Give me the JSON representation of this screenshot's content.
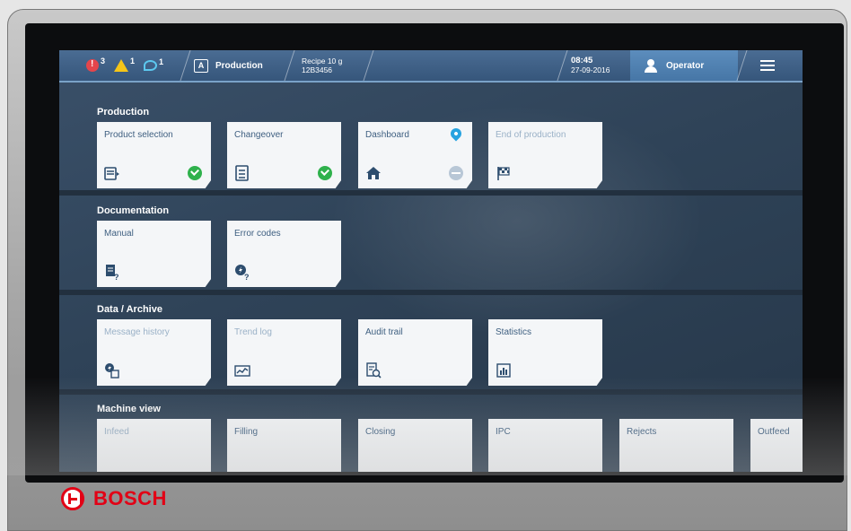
{
  "topbar": {
    "errors": {
      "count": "3",
      "icon": "error-icon"
    },
    "warnings": {
      "count": "1",
      "icon": "warning-icon"
    },
    "messages": {
      "count": "1",
      "icon": "message-icon"
    },
    "mode_icon_letter": "A",
    "mode_label": "Production",
    "recipe_name": "Recipe 10 g",
    "recipe_id": "12B3456",
    "time": "08:45",
    "date": "27-09-2016",
    "user": "Operator"
  },
  "sections": [
    {
      "title": "Production",
      "tiles": [
        {
          "label": "Product selection",
          "icon": "product-selection-icon",
          "status": "ok",
          "enabled": true
        },
        {
          "label": "Changeover",
          "icon": "checklist-icon",
          "status": "ok",
          "enabled": true
        },
        {
          "label": "Dashboard",
          "icon": "home-icon",
          "status": "inactive",
          "pinned": true,
          "enabled": true
        },
        {
          "label": "End of production",
          "icon": "finish-flag-icon",
          "status": "",
          "enabled": false
        }
      ]
    },
    {
      "title": "Documentation",
      "tiles": [
        {
          "label": "Manual",
          "icon": "manual-icon",
          "enabled": true
        },
        {
          "label": "Error codes",
          "icon": "error-codes-icon",
          "enabled": true
        }
      ]
    },
    {
      "title": "Data / Archive",
      "tiles": [
        {
          "label": "Message history",
          "icon": "message-history-icon",
          "enabled": false
        },
        {
          "label": "Trend log",
          "icon": "trend-icon",
          "enabled": false
        },
        {
          "label": "Audit trail",
          "icon": "audit-icon",
          "enabled": true
        },
        {
          "label": "Statistics",
          "icon": "statistics-icon",
          "enabled": true
        }
      ]
    },
    {
      "title": "Machine view",
      "tiles": [
        {
          "label": "Infeed",
          "icon": "infeed-icon",
          "enabled": false
        },
        {
          "label": "Filling",
          "icon": "filling-icon",
          "status": "error",
          "enabled": true
        },
        {
          "label": "Closing",
          "icon": "closing-icon",
          "enabled": true
        },
        {
          "label": "IPC",
          "icon": "scale-icon",
          "enabled": true
        },
        {
          "label": "Rejects",
          "icon": "rejects-icon",
          "enabled": true
        },
        {
          "label": "Outfeed",
          "icon": "outfeed-icon",
          "enabled": true
        }
      ]
    }
  ],
  "brand": "BOSCH",
  "colors": {
    "accent": "#4676a6",
    "tile_text": "#3e5f80",
    "ok": "#2fb14c",
    "error": "#e5454b",
    "warning": "#f5c518",
    "brand": "#e20015"
  }
}
